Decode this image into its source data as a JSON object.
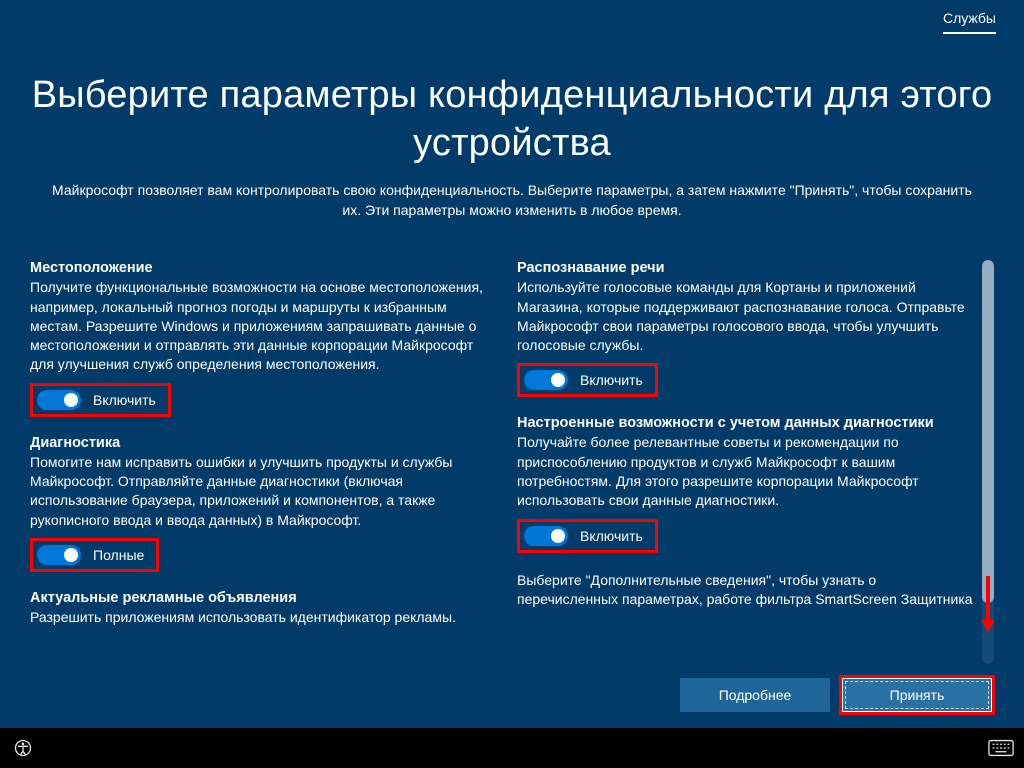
{
  "topbar": {
    "tab": "Службы"
  },
  "page": {
    "title": "Выберите параметры конфиденциальности для этого устройства",
    "intro": "Майкрософт позволяет вам контролировать свою конфиденциальность. Выберите параметры, а затем нажмите \"Принять\", чтобы сохранить их. Эти параметры можно изменить в любое время."
  },
  "settings": {
    "location": {
      "title": "Местоположение",
      "desc": "Получите функциональные возможности на основе местоположения, например, локальный прогноз погоды и маршруты к избранным местам. Разрешите Windows и приложениям запрашивать данные о местоположении и отправлять эти данные корпорации Майкрософт для улучшения служб определения местоположения.",
      "toggle": "Включить"
    },
    "diagnostics": {
      "title": "Диагностика",
      "desc": "Помогите нам исправить ошибки и улучшить продукты и службы Майкрософт. Отправляйте данные диагностики (включая использование браузера, приложений и компонентов, а также рукописного ввода и ввода данных) в Майкрософт.",
      "toggle": "Полные"
    },
    "ads": {
      "title": "Актуальные рекламные объявления",
      "desc": "Разрешить приложениям использовать идентификатор рекламы."
    },
    "speech": {
      "title": "Распознавание речи",
      "desc": "Используйте голосовые команды для Кортаны и приложений Магазина, которые поддерживают распознавание голоса. Отправьте Майкрософт свои параметры голосового ввода, чтобы улучшить голосовые службы.",
      "toggle": "Включить"
    },
    "tailored": {
      "title": "Настроенные возможности с учетом данных диагностики",
      "desc": "Получайте более релевантные советы и рекомендации по приспособлению продуктов и служб Майкрософт к вашим потребностям. Для этого разрешите корпорации Майкрософт использовать свои данные диагностики.",
      "toggle": "Включить"
    },
    "footnote": "Выберите \"Дополнительные сведения\", чтобы узнать о перечисленных параметрах, работе фильтра SmartScreen Защитника"
  },
  "buttons": {
    "more": "Подробнее",
    "accept": "Принять"
  }
}
